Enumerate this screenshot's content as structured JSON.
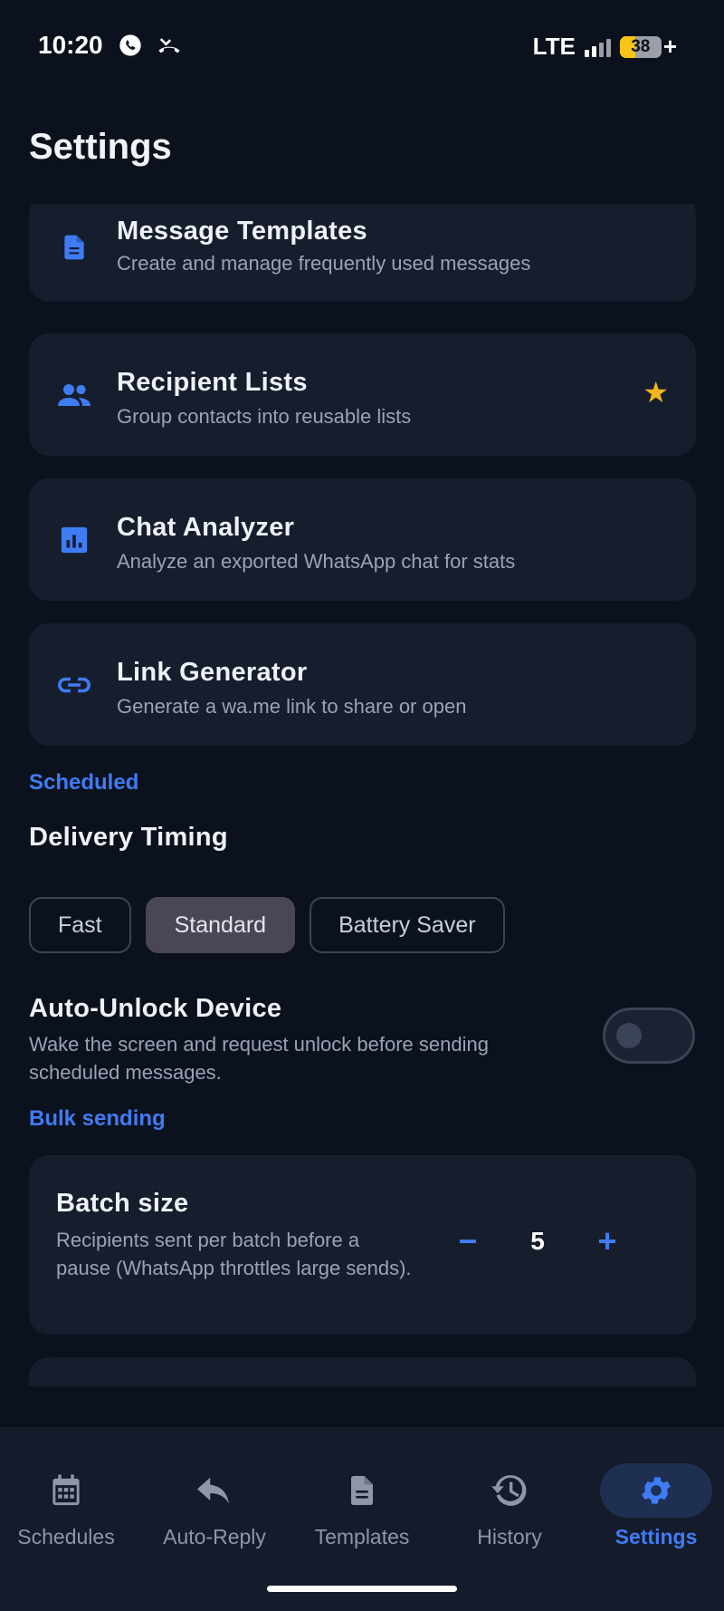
{
  "status": {
    "time": "10:20",
    "network": "LTE",
    "battery_level": "38",
    "charging": "+"
  },
  "page": {
    "title": "Settings"
  },
  "cards": [
    {
      "title": "Message Templates",
      "subtitle": "Create and manage frequently used messages",
      "icon": "document-icon"
    },
    {
      "title": "Recipient Lists",
      "subtitle": "Group contacts into reusable lists",
      "icon": "group-icon",
      "badge": "star-icon"
    },
    {
      "title": "Chat Analyzer",
      "subtitle": "Analyze an exported WhatsApp chat for stats",
      "icon": "chart-icon"
    },
    {
      "title": "Link Generator",
      "subtitle": "Generate a wa.me link to share or open",
      "icon": "link-icon"
    }
  ],
  "scheduled": {
    "section_label": "Scheduled",
    "delivery_title": "Delivery Timing",
    "options": [
      "Fast",
      "Standard",
      "Battery Saver"
    ],
    "selected": "Standard",
    "auto_unlock_title": "Auto-Unlock Device",
    "auto_unlock_desc": "Wake the screen and request unlock before sending scheduled messages.",
    "auto_unlock_on": false
  },
  "bulk": {
    "section_label": "Bulk sending",
    "batch_title": "Batch size",
    "batch_desc": "Recipients sent per batch before a pause (WhatsApp throttles large sends).",
    "batch_value": "5",
    "minus": "−",
    "plus": "+"
  },
  "nav": [
    {
      "label": "Schedules",
      "icon": "calendar-icon"
    },
    {
      "label": "Auto-Reply",
      "icon": "reply-icon"
    },
    {
      "label": "Templates",
      "icon": "document-icon"
    },
    {
      "label": "History",
      "icon": "history-icon"
    },
    {
      "label": "Settings",
      "icon": "gear-icon",
      "active": true
    }
  ],
  "colors": {
    "accent": "#3f7cf4",
    "star": "#f3b61f",
    "background": "#0b111d",
    "card": "#161d2d"
  }
}
